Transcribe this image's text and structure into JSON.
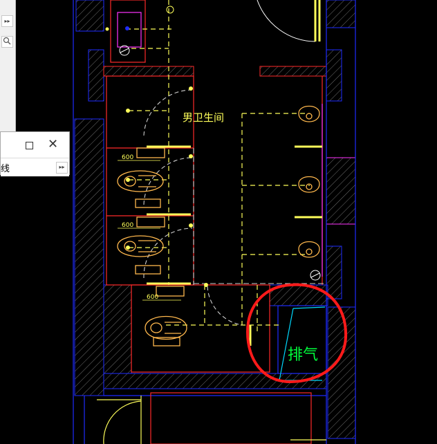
{
  "drawing": {
    "room_label": "男卫生间",
    "exhaust_label": "排气",
    "dimension_labels": [
      "600",
      "600",
      "600"
    ]
  },
  "left_panel": {
    "expand_glyph": "▸▸",
    "search_icon": "search-icon"
  },
  "floating_window": {
    "maximize_icon": "maximize-icon",
    "close_glyph": "✕",
    "row_label": "线",
    "expand_glyph": "▸▸"
  },
  "colors": {
    "background": "#000000",
    "wall_red": "#ff2a2a",
    "wall_blue": "#1e2bff",
    "fixture_yellow": "#ffff5a",
    "fixture_orange": "#ffb84d",
    "hatch_gray": "#6f6f6f",
    "magenta": "#ff33ff",
    "annotation_red": "#ff1a1a",
    "exhaust_green": "#00ff3c",
    "cyan": "#00d9ff",
    "dash_white": "#cfcfcf"
  }
}
